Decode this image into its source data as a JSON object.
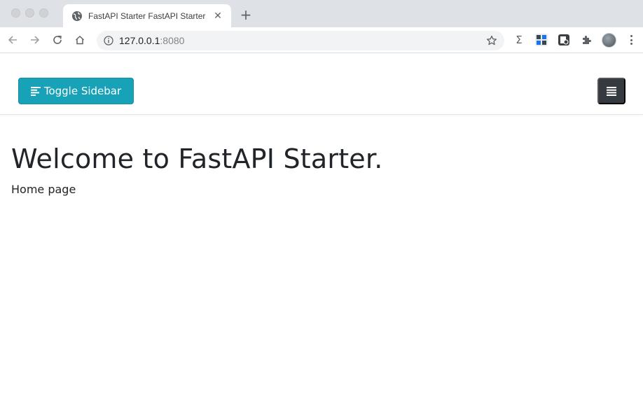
{
  "browser": {
    "tab": {
      "title": "FastAPI Starter FastAPI Starter",
      "close_glyph": "✕",
      "favicon_icon": "globe-icon"
    },
    "new_tab_glyph": "+",
    "address": {
      "host": "127.0.0.1",
      "port": ":8080",
      "info_icon": "info-icon",
      "bookmark_icon": "star-icon"
    },
    "nav_icons": [
      "back-arrow-icon",
      "forward-arrow-icon",
      "reload-icon",
      "home-icon"
    ],
    "extensions": {
      "sigma_glyph": "Σ",
      "items": [
        "sigma-extension-icon",
        "extension-tile-icon",
        "document-extension-icon",
        "puzzle-icon",
        "profile-avatar"
      ]
    }
  },
  "page": {
    "toggle_button_label": "Toggle Sidebar",
    "title": "Welcome to FastAPI Starter.",
    "text": "Home page"
  },
  "colors": {
    "toggle_button_bg": "#17a2b8",
    "menu_button_bg": "#343a40",
    "text": "#212529"
  }
}
